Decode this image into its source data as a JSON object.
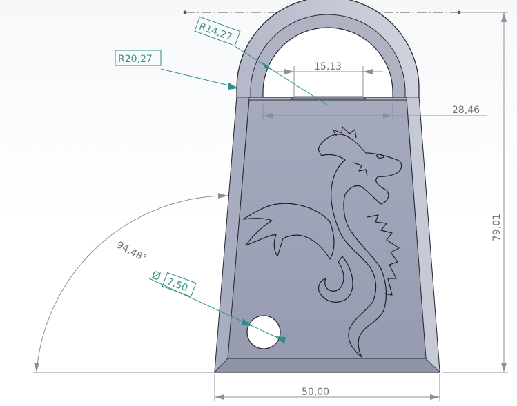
{
  "drawing": {
    "dimensions": {
      "radius_outer": "R20,27",
      "radius_inner": "R14,27",
      "slot_width": "15,13",
      "top_width": "28,46",
      "overall_height": "79,01",
      "bottom_width": "50,00",
      "side_angle": "94,48°",
      "hole_symbol": "Ø",
      "hole_diameter": "7,50"
    },
    "colors": {
      "part_face": "#9ea2b6",
      "part_edge": "#b8bccc",
      "part_outline": "#2a2c33",
      "dimension": "#8c9094",
      "annotation": "#2f8f84"
    },
    "icons": {
      "engraving": "dragon-engraving-icon",
      "hole": "keyring-hole-icon"
    }
  }
}
